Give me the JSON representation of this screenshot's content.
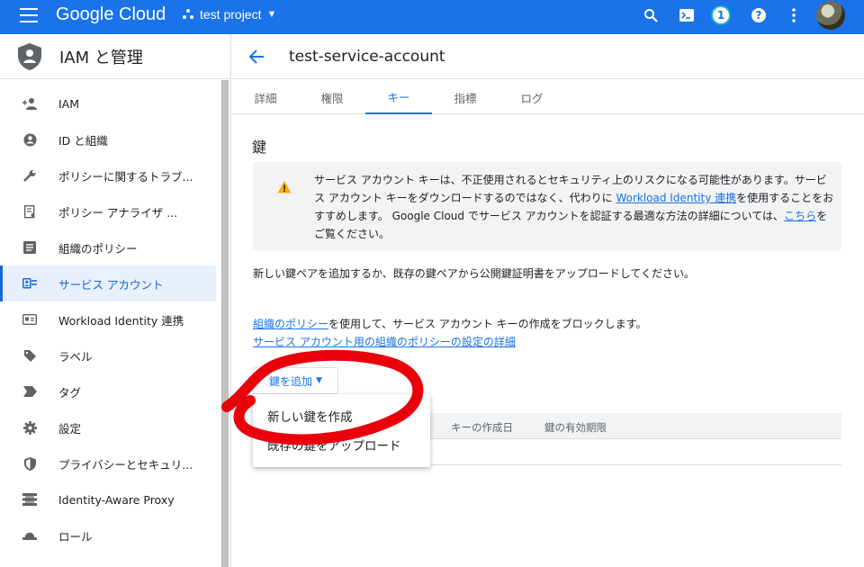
{
  "topbar": {
    "logo": "Google Cloud",
    "project": "test project",
    "notification_count": "1",
    "help": "?"
  },
  "sidebar": {
    "title": "IAM と管理",
    "items": [
      {
        "label": "IAM",
        "icon": "person-add-icon"
      },
      {
        "label": "ID と組織",
        "icon": "account-circle-icon"
      },
      {
        "label": "ポリシーに関するトラブ...",
        "icon": "wrench-icon"
      },
      {
        "label": "ポリシー アナライザ ...",
        "icon": "policy-analyzer-icon"
      },
      {
        "label": "組織のポリシー",
        "icon": "list-icon"
      },
      {
        "label": "サービス アカウント",
        "icon": "service-account-icon",
        "active": true
      },
      {
        "label": "Workload Identity 連携",
        "icon": "id-card-icon"
      },
      {
        "label": "ラベル",
        "icon": "label-icon"
      },
      {
        "label": "タグ",
        "icon": "tag-icon"
      },
      {
        "label": "設定",
        "icon": "gear-icon"
      },
      {
        "label": "プライバシーとセキュリ...",
        "icon": "shield-icon"
      },
      {
        "label": "Identity-Aware Proxy",
        "icon": "proxy-icon"
      },
      {
        "label": "ロール",
        "icon": "role-hat-icon"
      }
    ]
  },
  "main": {
    "title": "test-service-account",
    "tabs": [
      "詳細",
      "権限",
      "キー",
      "指標",
      "ログ"
    ],
    "active_tab": "キー",
    "section_title": "鍵",
    "notice": {
      "text1": "サービス アカウント キーは、不正使用されるとセキュリティ上のリスクになる可能性があります。サービス アカウント キーをダウンロードするのではなく、代わりに ",
      "link1": "Workload Identity 連携",
      "text2": "を使用することをおすすめします。 Google Cloud でサービス アカウントを認証する最適な方法の詳細については、",
      "link2": "こちら",
      "text3": "をご覧ください。"
    },
    "para1": "新しい鍵ペアを追加するか、既存の鍵ペアから公開鍵証明書をアップロードしてください。",
    "para2_link": "組織のポリシー",
    "para2_text": "を使用して、サービス アカウント キーの作成をブロックします。",
    "para2_link2": "サービス アカウント用の組織のポリシーの設定の詳細",
    "add_key_label": "鍵を追加",
    "table_headers": [
      "キーの作成日",
      "鍵の有効期限"
    ],
    "dropdown": [
      "新しい鍵を作成",
      "既存の鍵をアップロード"
    ]
  },
  "colors": {
    "accent": "#1a73e8",
    "annotation": "#e8000b",
    "warning": "#f9ab00"
  }
}
